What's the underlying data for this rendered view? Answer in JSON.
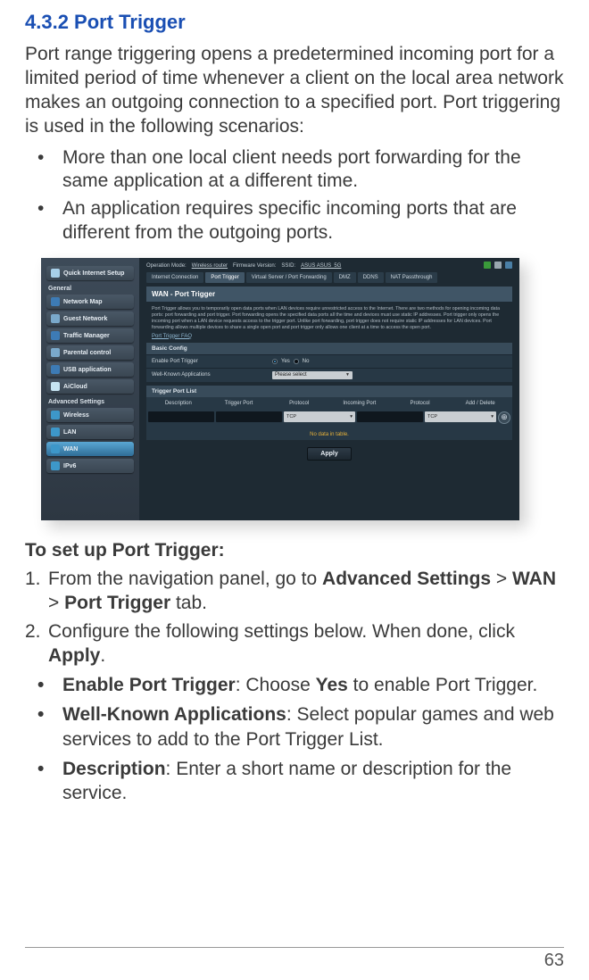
{
  "heading": "4.3.2 Port Trigger",
  "intro": "Port range triggering opens a predetermined incoming port for a limited period of time whenever a client on the local area network makes an outgoing connection to a specified port. Port triggering is used in the following scenarios:",
  "bullets": [
    "More than one local client needs port forwarding for the same application at a different time.",
    "An application requires specific incoming ports that are different from the outgoing ports."
  ],
  "setup_heading": "To set up Port Trigger:",
  "steps": [
    {
      "num": "1.",
      "pre": "From the navigation panel, go to ",
      "boldpath": [
        "Advanced Settings",
        " > ",
        "WAN",
        " > ",
        "Port Trigger"
      ],
      "post": " tab."
    },
    {
      "num": "2.",
      "pre": "Configure the following settings below. When done, click ",
      "boldpath": [
        "Apply"
      ],
      "post": "."
    }
  ],
  "subs": [
    {
      "label": "Enable Port Trigger",
      "text": ": Choose ",
      "mid": "Yes",
      "after": " to enable Port Trigger."
    },
    {
      "label": "Well-Known Applications",
      "text": ": Select popular games and web services to add to the Port Trigger List."
    },
    {
      "label": "Description",
      "text": ": Enter a short name or description for the service."
    }
  ],
  "page_number": "63",
  "ss": {
    "sidebar": {
      "qis": "Quick Internet Setup",
      "sec1": "General",
      "items1": [
        "Network Map",
        "Guest Network",
        "Traffic Manager",
        "Parental control",
        "USB application",
        "AiCloud"
      ],
      "sec2": "Advanced Settings",
      "items2": [
        "Wireless",
        "LAN",
        "WAN",
        "IPv6"
      ]
    },
    "topbar": {
      "op": "Operation Mode:",
      "opv": "Wireless router",
      "fw": "Firmware Version:",
      "ssid": "SSID:",
      "ssidv": "ASUS  ASUS_5G"
    },
    "tabs": [
      "Internet Connection",
      "Port Trigger",
      "Virtual Server / Port Forwarding",
      "DMZ",
      "DDNS",
      "NAT Passthrough"
    ],
    "panel_title": "WAN - Port Trigger",
    "panel_desc": "Port Trigger allows you to temporarily open data ports when LAN devices require unrestricted access to the Internet. There are two methods for opening incoming data ports: port forwarding and port trigger. Port forwarding opens the specified data ports all the time and devices must use static IP addresses. Port trigger only opens the incoming port when a LAN device requests access to the trigger port. Unlike port forwarding, port trigger does not require static IP addresses for LAN devices. Port forwarding allows multiple devices to share a single open port and port trigger only allows one client at a time to access the open port.",
    "faq": "Port Trigger FAQ",
    "basic": "Basic Config",
    "ept_label": "Enable Port Trigger",
    "ept_yes": "Yes",
    "ept_no": "No",
    "wka_label": "Well-Known Applications",
    "wka_select": "Please select",
    "listhead": "Trigger Port List",
    "cols": [
      "Description",
      "Trigger Port",
      "Protocol",
      "Incoming Port",
      "Protocol",
      "Add / Delete"
    ],
    "tcp": "TCP",
    "nodata": "No data in table.",
    "apply": "Apply"
  }
}
